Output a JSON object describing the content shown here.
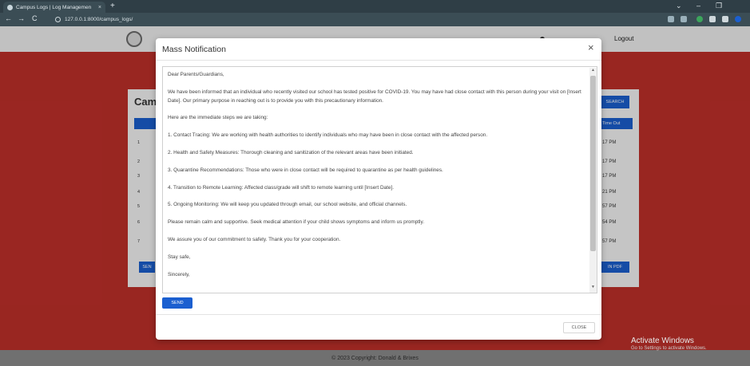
{
  "browser": {
    "tab_title": "Campus Logs | Log Managemen",
    "tab_close": "×",
    "new_tab": "+",
    "url": "127.0.0.1:8000/campus_logs/",
    "back": "←",
    "forward": "→",
    "reload": "C",
    "win_min": "–",
    "win_max": "❐",
    "win_dropdown": "⌄"
  },
  "site": {
    "logout_label": "Logout",
    "card_title": "Camp",
    "search_label": "SEARCH",
    "time_out_header": "Time Out",
    "row_numbers": [
      "1",
      "2",
      "3",
      "4",
      "5",
      "6",
      "7"
    ],
    "time_outs": [
      "17 PM",
      "17 PM",
      "17 PM",
      "21 PM",
      "57 PM",
      "54 PM",
      "57 PM"
    ],
    "left_button": "SEN",
    "pdf_button": "IN PDF",
    "footer": "© 2023 Copyright: Donald & Brixes"
  },
  "modal": {
    "title": "Mass Notification",
    "close_x": "×",
    "message": [
      "Dear Parents/Guardians,",
      "We have been informed that an individual who recently visited our school has tested positive for COVID-19. You may have had close contact with this person during your visit on [Insert Date]. Our primary purpose in reaching out is to provide you with this precautionary information.",
      "Here are the immediate steps we are taking:",
      "1. Contact Tracing: We are working with health authorities to identify individuals who may have been in close contact with the affected person.",
      "2. Health and Safety Measures: Thorough cleaning and sanitization of the relevant areas have been initiated.",
      "3. Quarantine Recommendations: Those who were in close contact will be required to quarantine as per health guidelines.",
      "4. Transition to Remote Learning: Affected class/grade will shift to remote learning until [Insert Date].",
      "5. Ongoing Monitoring: We will keep you updated through email, our school website, and official channels.",
      "Please remain calm and supportive. Seek medical attention if your child shows symptoms and inform us promptly.",
      "We assure you of our commitment to safety. Thank you for your cooperation.",
      "Stay safe,",
      "Sincerely,"
    ],
    "send_label": "SEND",
    "close_label": "CLOSE"
  },
  "watermark": {
    "title": "Activate Windows",
    "subtitle": "Go to Settings to activate Windows."
  },
  "colors": {
    "primary": "#1b5fd0",
    "header_red": "#c0302a",
    "browser_chrome": "#3b4d55"
  }
}
